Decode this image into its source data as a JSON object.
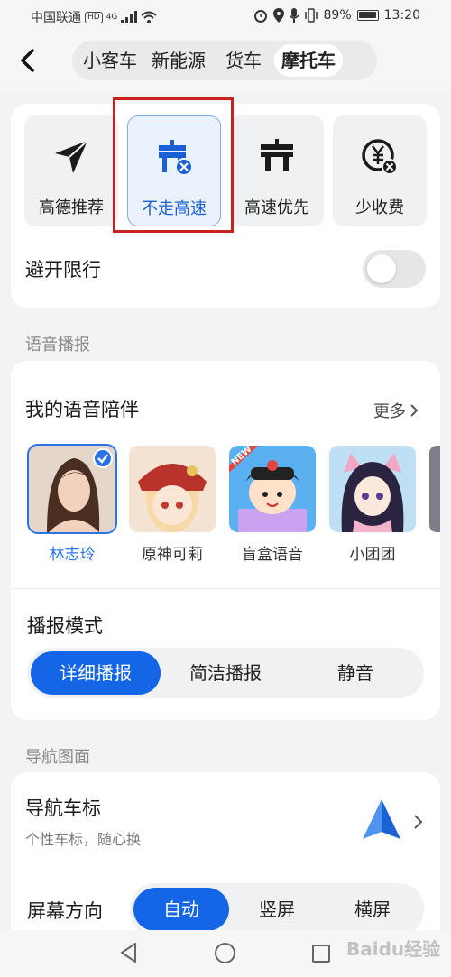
{
  "status_bar": {
    "carrier": "中国联通",
    "hd_badge": "HD",
    "network": "4G",
    "battery_text": "89%",
    "time": "13:20"
  },
  "vehicle_tabs": [
    {
      "label": "小客车",
      "active": false
    },
    {
      "label": "新能源",
      "active": false
    },
    {
      "label": "货车",
      "active": false
    },
    {
      "label": "摩托车",
      "active": true
    }
  ],
  "route_preferences": {
    "options": [
      {
        "label": "高德推荐",
        "icon": "send-arrow-icon",
        "selected": false
      },
      {
        "label": "不走高速",
        "icon": "no-highway-icon",
        "selected": true
      },
      {
        "label": "高速优先",
        "icon": "highway-icon",
        "selected": false
      },
      {
        "label": "少收费",
        "icon": "less-toll-icon",
        "selected": false
      }
    ],
    "avoid_restriction_label": "避开限行",
    "avoid_restriction_on": false
  },
  "voice_section": {
    "section_title": "语音播报",
    "companion_title": "我的语音陪伴",
    "more_label": "更多",
    "voices": [
      {
        "name": "林志玲",
        "selected": true
      },
      {
        "name": "原神可莉",
        "selected": false
      },
      {
        "name": "盲盒语音",
        "selected": false,
        "badge": "NEW"
      },
      {
        "name": "小团团",
        "selected": false
      }
    ],
    "broadcast_mode_title": "播报模式",
    "broadcast_modes": [
      {
        "label": "详细播报",
        "active": true
      },
      {
        "label": "简洁播报",
        "active": false
      },
      {
        "label": "静音",
        "active": false
      }
    ]
  },
  "display_section": {
    "section_title": "导航图面",
    "car_icon_title": "导航车标",
    "car_icon_subtitle": "个性车标，随心换",
    "orientation_title": "屏幕方向",
    "orientations": [
      {
        "label": "自动",
        "active": true
      },
      {
        "label": "竖屏",
        "active": false
      },
      {
        "label": "横屏",
        "active": false
      }
    ]
  },
  "watermark": "Baidu经验",
  "colors": {
    "accent": "#1466e6",
    "selected_border": "#cc1f1f",
    "card_bg": "#ffffff",
    "page_bg": "#f2f3f5"
  }
}
